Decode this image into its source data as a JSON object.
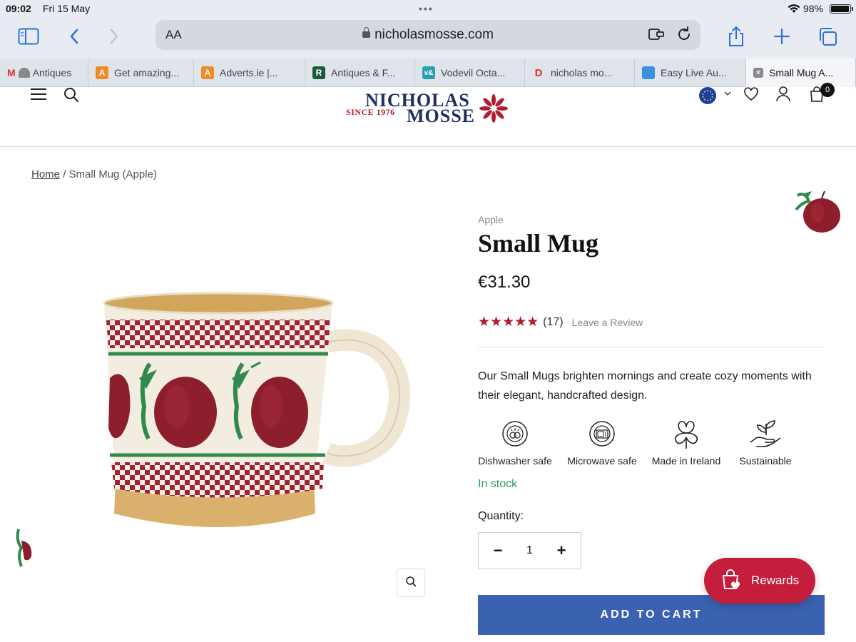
{
  "status_bar": {
    "time": "09:02",
    "date": "Fri 15 May",
    "battery": "98%",
    "battery_level": 0.98
  },
  "browser": {
    "text_size_label": "AA",
    "url": "nicholasmosse.com",
    "tabs": [
      {
        "label": "Antiques",
        "icon": "gmail-icon"
      },
      {
        "label": "Get amazing...",
        "icon": "adverts-icon"
      },
      {
        "label": "Adverts.ie |...",
        "icon": "adverts-icon"
      },
      {
        "label": "Antiques & F...",
        "icon": "r-icon"
      },
      {
        "label": "Vodevil Octa...",
        "icon": "vodevil-icon"
      },
      {
        "label": "nicholas mo...",
        "icon": "d-icon"
      },
      {
        "label": "Easy Live Au...",
        "icon": "easylive-icon"
      },
      {
        "label": "Small Mug A...",
        "icon": "close-icon",
        "active": true
      }
    ]
  },
  "site": {
    "logo": {
      "line1": "NICHOLAS",
      "since": "SINCE 1976",
      "line2": "MOSSE"
    },
    "cart_count": "0"
  },
  "breadcrumb": {
    "home": "Home",
    "separator": "/",
    "current": "Small Mug (Apple)"
  },
  "product": {
    "vendor": "Apple",
    "title": "Small Mug",
    "price": "€31.30",
    "rating": {
      "stars": 5,
      "count": "(17)",
      "review_link": "Leave a Review"
    },
    "description": "Our Small Mugs brighten mornings and create cozy moments with their elegant, handcrafted design.",
    "features": [
      {
        "label": "Dishwasher safe",
        "icon": "dishwasher-safe-icon"
      },
      {
        "label": "Microwave safe",
        "icon": "microwave-safe-icon"
      },
      {
        "label": "Made in Ireland",
        "icon": "shamrock-icon"
      },
      {
        "label": "Sustainable",
        "icon": "sustainable-icon"
      }
    ],
    "stock": "In stock",
    "quantity_label": "Quantity:",
    "quantity": "1",
    "add_to_cart": "ADD TO CART"
  },
  "rewards": {
    "label": "Rewards"
  },
  "colors": {
    "brand_navy": "#1f2f63",
    "brand_red": "#b01c30",
    "button_blue": "#3b62b0",
    "stock_green": "#2c9c5e",
    "rewards_red": "#c51d3c"
  }
}
